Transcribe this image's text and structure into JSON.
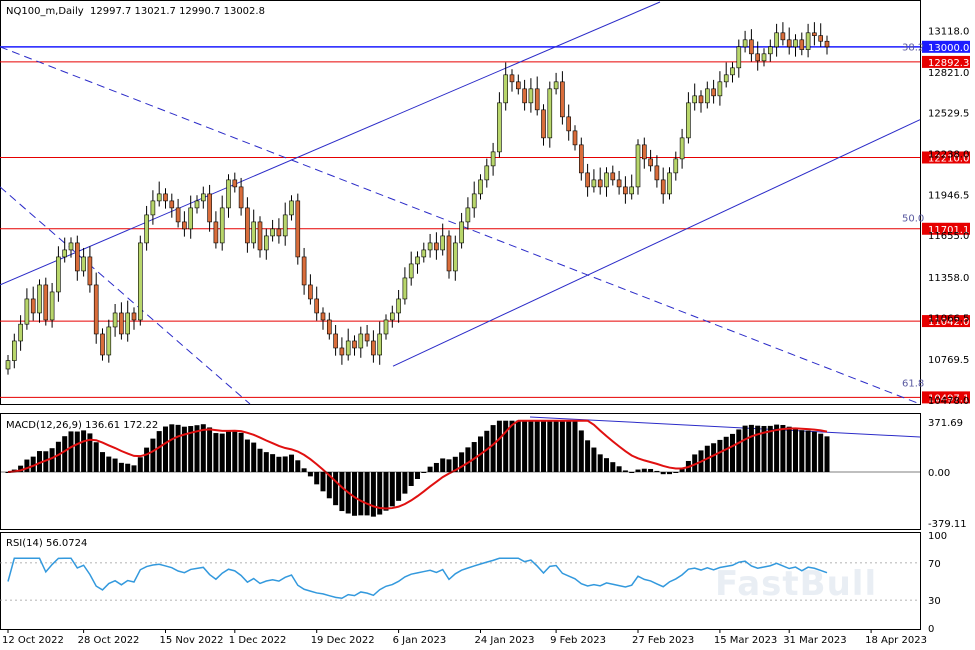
{
  "chart_data": {
    "type": "candlestick",
    "symbol_header": "NQ100_m,Daily",
    "ohlc_header": "12997.7 13021.7 12990.7 13002.8",
    "price_ticks": [
      "13118.0",
      "12821.0",
      "12529.5",
      "12238.0",
      "11946.5",
      "11655.0",
      "11358.0",
      "11066.5",
      "10769.5",
      "10478.0"
    ],
    "price_range": [
      10450,
      13320
    ],
    "horizontal_levels": [
      {
        "label": "13000.0",
        "value": 13000.0,
        "color": "#1c1cff"
      },
      {
        "label": "12892.3",
        "value": 12892.3,
        "color": "#e60000"
      },
      {
        "label": "12210.0",
        "value": 12210.0,
        "color": "#e60000"
      },
      {
        "label": "11701.1",
        "value": 11701.1,
        "color": "#e60000"
      },
      {
        "label": "11042.0",
        "value": 11042.0,
        "color": "#e60000"
      },
      {
        "label": "10497.1",
        "value": 10497.1,
        "color": "#e60000"
      }
    ],
    "fib_labels": [
      {
        "label": "38.2",
        "value": 12960
      },
      {
        "label": "50.0",
        "value": 11740
      },
      {
        "label": "61.8",
        "value": 10560
      }
    ],
    "date_labels": [
      "12 Oct 2022",
      "28 Oct 2022",
      "15 Nov 2022",
      "1 Dec 2022",
      "19 Dec 2022",
      "6 Jan 2023",
      "24 Jan 2023",
      "9 Feb 2023",
      "27 Feb 2023",
      "15 Mar 2023",
      "31 Mar 2023",
      "18 Apr 2023"
    ],
    "date_label_bar_index": [
      0,
      12,
      25,
      36,
      49,
      62,
      75,
      87,
      100,
      113,
      124,
      137
    ],
    "candles_close": [
      10760,
      10900,
      11020,
      11200,
      11100,
      11300,
      11050,
      11250,
      11500,
      11550,
      11600,
      11400,
      11500,
      11300,
      10950,
      10800,
      11000,
      11100,
      10950,
      11100,
      11050,
      11600,
      11800,
      11900,
      11950,
      11900,
      11850,
      11750,
      11700,
      11850,
      11900,
      11950,
      11750,
      11600,
      11850,
      12050,
      12000,
      11850,
      11600,
      11750,
      11550,
      11650,
      11700,
      11650,
      11800,
      11900,
      11500,
      11300,
      11200,
      11100,
      11050,
      10950,
      10850,
      10800,
      10900,
      10850,
      10950,
      10900,
      10800,
      10950,
      11050,
      11100,
      11200,
      11350,
      11450,
      11500,
      11550,
      11600,
      11550,
      11650,
      11400,
      11600,
      11750,
      11850,
      11950,
      12050,
      12150,
      12250,
      12600,
      12800,
      12750,
      12700,
      12600,
      12700,
      12550,
      12350,
      12700,
      12750,
      12500,
      12400,
      12300,
      12100,
      12000,
      12050,
      12000,
      12100,
      12050,
      12000,
      11950,
      12000,
      12300,
      12200,
      12150,
      12050,
      11950,
      12100,
      12200,
      12350,
      12600,
      12650,
      12600,
      12700,
      12650,
      12750,
      12800,
      12850,
      13000,
      13050,
      12950,
      12900,
      12950,
      13000,
      13100,
      13050,
      13000,
      13050,
      12980,
      13100,
      13080,
      13040,
      13000
    ],
    "macd_header": "MACD(12,26,9) 136.61 172.22",
    "macd_ticks": [
      "371.69",
      "0.00",
      "-379.11"
    ],
    "macd_range": [
      -400,
      400
    ],
    "rsi_header": "RSI(14) 56.0724",
    "rsi_ticks": [
      "100",
      "70",
      "30",
      "0"
    ],
    "watermark": "FastBull"
  }
}
